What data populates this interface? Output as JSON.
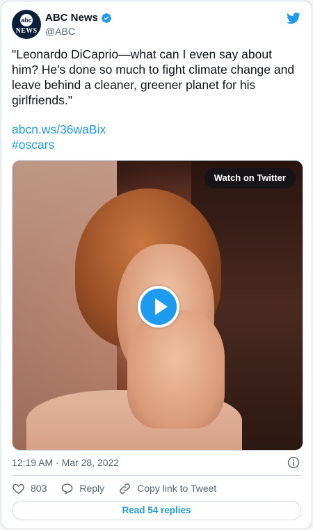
{
  "account": {
    "display_name": "ABC News",
    "handle": "@ABC",
    "avatar_text_top": "abc",
    "avatar_text_bottom": "NEWS",
    "verified": true
  },
  "tweet": {
    "text": "\"Leonardo DiCaprio—what can I even say about him? He's done so much to fight climate change and leave behind a cleaner, greener planet for his girlfriends.\"",
    "link": "abcn.ws/36waBix",
    "hashtag": "#oscars"
  },
  "media": {
    "watch_label": "Watch on Twitter",
    "play_icon": "play-icon"
  },
  "meta": {
    "timestamp": "12:19 AM · Mar 28, 2022"
  },
  "actions": {
    "like_count": "803",
    "reply_label": "Reply",
    "copy_label": "Copy link to Tweet"
  },
  "footer": {
    "read_replies_label": "Read 54 replies"
  },
  "colors": {
    "accent": "#1d9bf0",
    "text": "#0f1419",
    "muted": "#536471",
    "border": "#cfd9de"
  }
}
